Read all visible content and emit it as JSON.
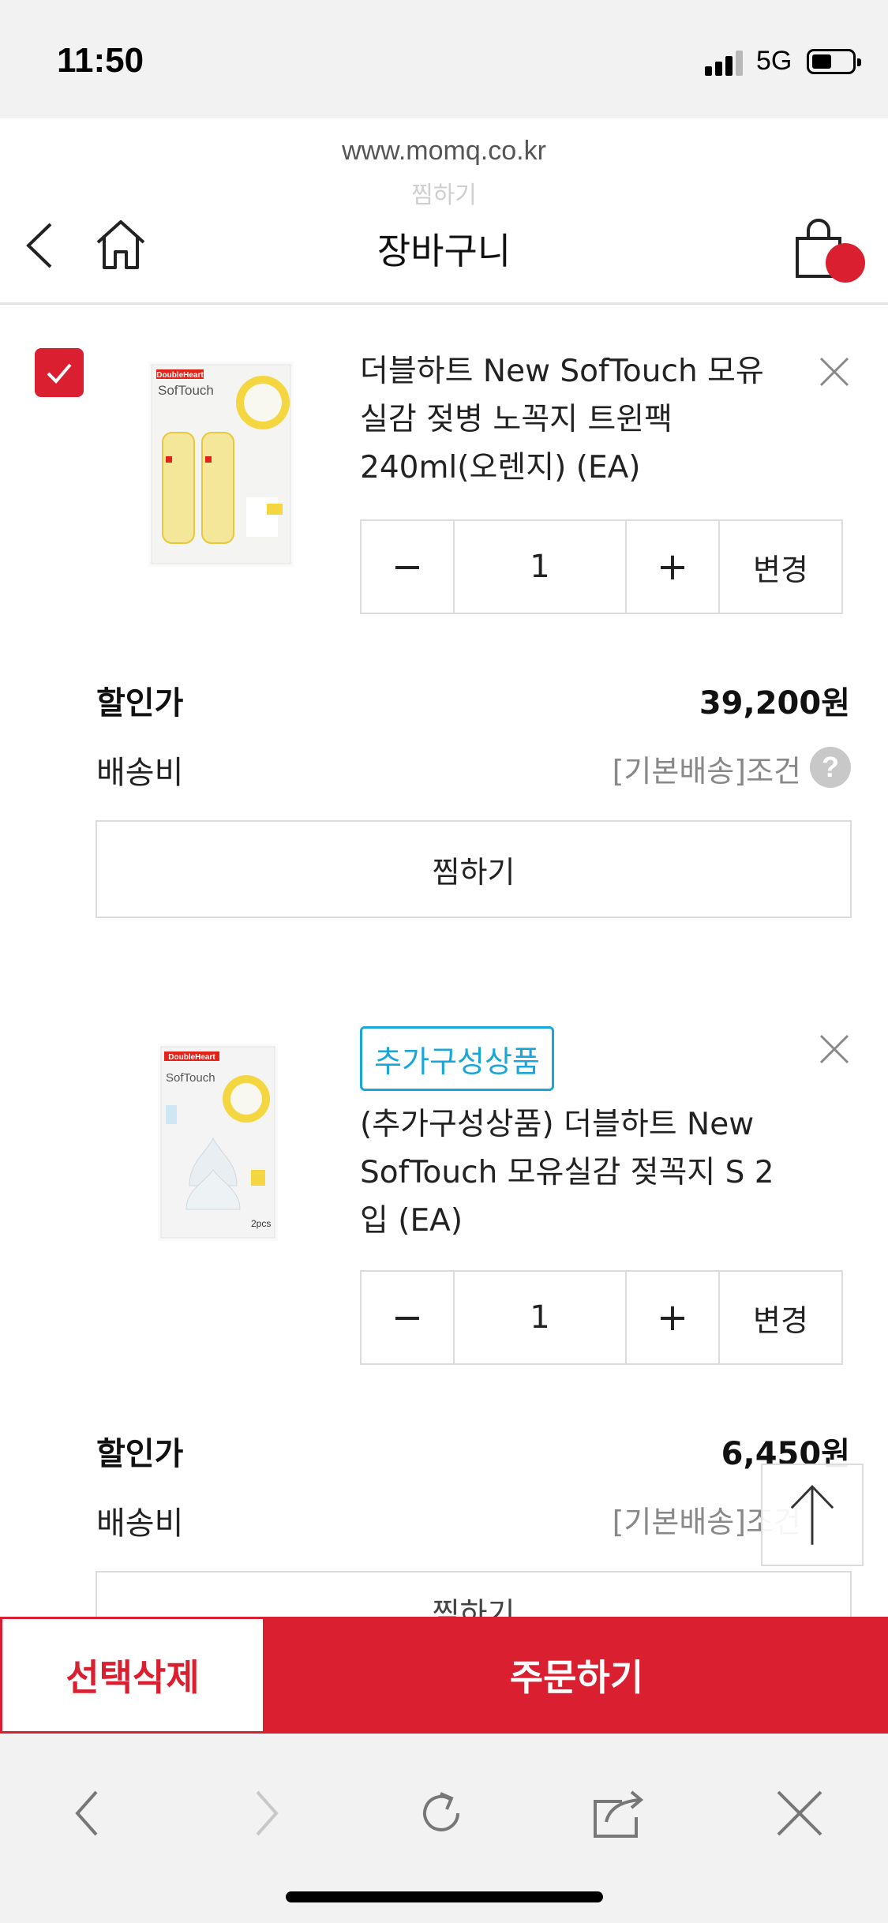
{
  "status": {
    "time": "11:50",
    "network": "5G"
  },
  "browser": {
    "url": "www.momq.co.kr"
  },
  "header": {
    "title": "장바구니",
    "ghost_text": "찜하기"
  },
  "items": [
    {
      "name": "더블하트 New SofTouch 모유실감 젖병 노꼭지 트윈팩 240ml(오렌지) (EA)",
      "name_lines": [
        "더블하트 New SofTouch 모유",
        "실감 젖병 노꼭지 트윈팩",
        "240ml(오렌지) (EA)"
      ],
      "image_text": [
        "DoubleHeart",
        "SofTouch"
      ],
      "quantity": "1",
      "change_label": "변경",
      "price_label": "할인가",
      "price": "39,200원",
      "shipping_label": "배송비",
      "shipping": "[기본배송]조건",
      "help_label": "?",
      "wish_label": "찜하기",
      "checked": true
    },
    {
      "badge": "추가구성상품",
      "name": "(추가구성상품) 더블하트 New SofTouch 모유실감 젖꼭지 S 2입 (EA)",
      "name_lines": [
        "(추가구성상품) 더블하트 New",
        "SofTouch 모유실감 젖꼭지 S 2",
        "입 (EA)"
      ],
      "image_text": [
        "DoubleHeart",
        "SofTouch",
        "2pcs"
      ],
      "quantity": "1",
      "change_label": "변경",
      "price_label": "할인가",
      "price": "6,450원",
      "shipping_label": "배송비",
      "shipping": "[기본배송]조건",
      "wish_label": "찜하기"
    }
  ],
  "actions": {
    "delete_selected": "선택삭제",
    "order": "주문하기"
  },
  "colors": {
    "brand_red": "#da2030",
    "addon_blue": "#1aa7d8",
    "product_yellow": "#f3d640"
  }
}
